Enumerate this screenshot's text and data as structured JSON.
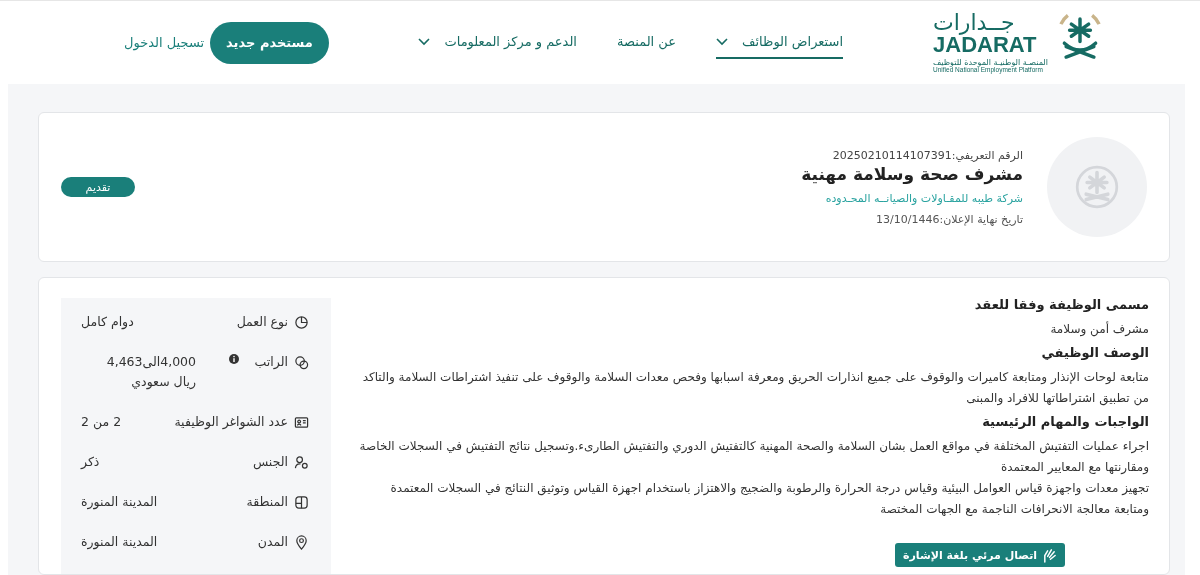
{
  "header": {
    "logo": {
      "arabic": "جــدارات",
      "latin": "JADARAT",
      "subtitle_ar": "المنصـة الوطنيـة الموحدة للتوظيف",
      "subtitle_en": "Unified National Employment Platform"
    },
    "nav": [
      {
        "label": "استعراض الوظائف",
        "dropdown": true,
        "selected": true
      },
      {
        "label": "عن المنصة",
        "dropdown": false,
        "selected": false
      },
      {
        "label": "الدعم و مركز المعلومات",
        "dropdown": true,
        "selected": false
      }
    ],
    "register_button": "مستخدم جديد",
    "login_link": "تسجيل الدخول"
  },
  "job": {
    "id_label": "الرقم التعريفي:",
    "id": "20250210114107391",
    "title": "مشرف صحة وسلامة مهنية",
    "company": "شركة طيبه للمقـاولات والصيانــه المحـدوده",
    "deadline_label": "تاريخ نهاية الإعلان:",
    "deadline": "13/10/1446",
    "apply_button": "تقديم"
  },
  "details": [
    {
      "kind": "schedule",
      "label": "نوع العمل",
      "value": "دوام كامل",
      "info": false
    },
    {
      "kind": "salary",
      "label": "الراتب",
      "value": "4,000الى4,463 ريال سعودي",
      "info": true
    },
    {
      "kind": "vacancies",
      "label": "عدد الشواغر الوظيفية",
      "value": "2 من 2",
      "info": false
    },
    {
      "kind": "gender",
      "label": "الجنس",
      "value": "ذكر",
      "info": false
    },
    {
      "kind": "region",
      "label": "المنطقة",
      "value": "المدينة المنورة",
      "info": false
    },
    {
      "kind": "city",
      "label": "المدن",
      "value": "المدينة المنورة",
      "info": false
    }
  ],
  "sections": [
    {
      "heading": "مسمى الوظيفة وفقا للعقد",
      "paragraphs": [
        "مشرف أمن وسلامة"
      ]
    },
    {
      "heading": "الوصف الوظيفي",
      "paragraphs": [
        "متابعة لوحات الإنذار ومتابعة كاميرات والوقوف على جميع انذارات الحريق ومعرفة اسبابها وفحص معدات السلامة والوقوف على تنفيذ اشتراطات السلامة والتاكد من تطبيق اشتراطاتها للافراد والمبنى"
      ]
    },
    {
      "heading": "الواجبات والمهام الرئيسية",
      "paragraphs": [
        "اجراء عمليات التفتيش المختلفة في مواقع العمل بشان السلامة والصحة المهنية كالتفتيش الدوري والتفتيش الطارىء.وتسجيل نتائج التفتيش في السجلات الخاصة ومقارنتها مع المعايير المعتمدة",
        "تجهيز معدات واجهزة قياس العوامل البيئية وقياس درجة الحرارة والرطوبة والضجيج والاهتزاز باستخدام اجهزة القياس وتوثيق النتائج في السجلات المعتمدة ومتابعة معالجة الانحرافات الناجمة مع الجهات المختصة"
      ]
    }
  ],
  "sign_language_button": "اتصال مرئي بلغة الإشارة"
}
